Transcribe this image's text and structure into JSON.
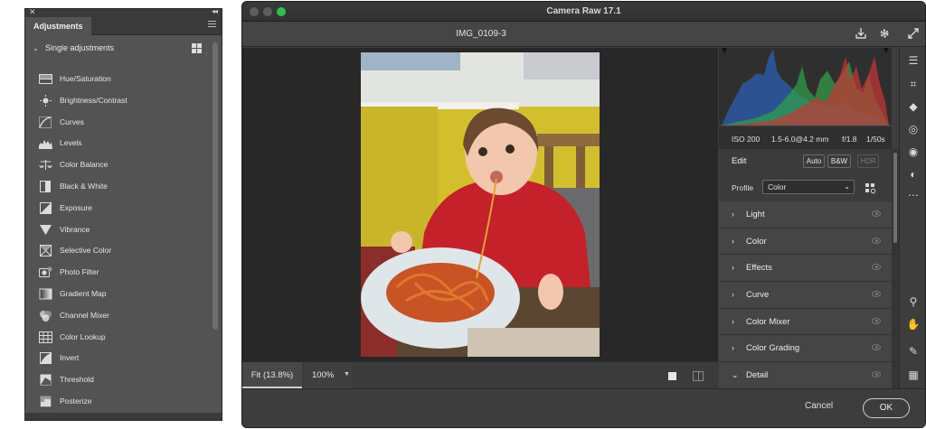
{
  "adjustments": {
    "tab_label": "Adjustments",
    "section_title": "Single adjustments",
    "items": [
      {
        "label": "Hue/Saturation",
        "icon": "hue-saturation-icon"
      },
      {
        "label": "Brightness/Contrast",
        "icon": "brightness-icon"
      },
      {
        "label": "Curves",
        "icon": "curves-icon"
      },
      {
        "label": "Levels",
        "icon": "levels-icon"
      },
      {
        "label": "Color Balance",
        "icon": "color-balance-icon"
      },
      {
        "label": "Black & White",
        "icon": "black-white-icon"
      },
      {
        "label": "Exposure",
        "icon": "exposure-icon"
      },
      {
        "label": "Vibrance",
        "icon": "vibrance-icon"
      },
      {
        "label": "Selective Color",
        "icon": "selective-color-icon"
      },
      {
        "label": "Photo Filter",
        "icon": "photo-filter-icon"
      },
      {
        "label": "Gradient Map",
        "icon": "gradient-map-icon"
      },
      {
        "label": "Channel Mixer",
        "icon": "channel-mixer-icon"
      },
      {
        "label": "Color Lookup",
        "icon": "color-lookup-icon"
      },
      {
        "label": "Invert",
        "icon": "invert-icon"
      },
      {
        "label": "Threshold",
        "icon": "threshold-icon"
      },
      {
        "label": "Posterize",
        "icon": "posterize-icon"
      }
    ]
  },
  "camera_raw": {
    "window_title": "Camera Raw 17.1",
    "file_name": "IMG_0109-3",
    "zoom": {
      "fit_label": "Fit (13.8%)",
      "percent_label": "100%"
    },
    "exif": {
      "iso": "ISO 200",
      "lens": "1.5-6.0@4.2 mm",
      "aperture": "f/1.8",
      "shutter": "1/50s"
    },
    "edit": {
      "title": "Edit",
      "auto": "Auto",
      "bw": "B&W",
      "hdr": "HDR"
    },
    "profile": {
      "label": "Profile",
      "value": "Color"
    },
    "sections": [
      {
        "label": "Light",
        "chevron": "›"
      },
      {
        "label": "Color",
        "chevron": "›"
      },
      {
        "label": "Effects",
        "chevron": "›"
      },
      {
        "label": "Curve",
        "chevron": "›"
      },
      {
        "label": "Color Mixer",
        "chevron": "›"
      },
      {
        "label": "Color Grading",
        "chevron": "›"
      },
      {
        "label": "Detail",
        "chevron": "⌄"
      }
    ],
    "buttons": {
      "cancel": "Cancel",
      "ok": "OK"
    }
  },
  "colors": {
    "accent_green": "#2ec14c",
    "panel_bg": "#535353",
    "window_bg": "#3d3d3d"
  }
}
